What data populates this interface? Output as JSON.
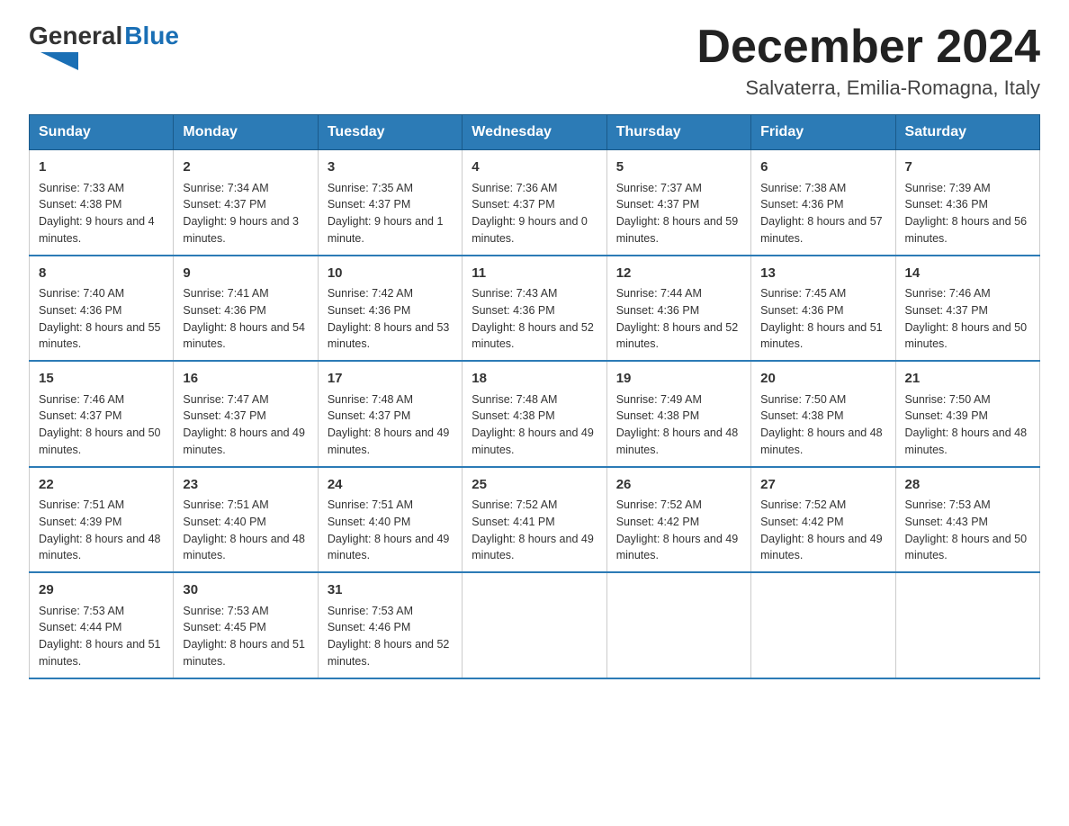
{
  "logo": {
    "text_general": "General",
    "text_blue": "Blue",
    "triangle": "▶"
  },
  "title": "December 2024",
  "subtitle": "Salvaterra, Emilia-Romagna, Italy",
  "days_of_week": [
    "Sunday",
    "Monday",
    "Tuesday",
    "Wednesday",
    "Thursday",
    "Friday",
    "Saturday"
  ],
  "weeks": [
    [
      {
        "num": "1",
        "sunrise": "7:33 AM",
        "sunset": "4:38 PM",
        "daylight": "9 hours and 4 minutes."
      },
      {
        "num": "2",
        "sunrise": "7:34 AM",
        "sunset": "4:37 PM",
        "daylight": "9 hours and 3 minutes."
      },
      {
        "num": "3",
        "sunrise": "7:35 AM",
        "sunset": "4:37 PM",
        "daylight": "9 hours and 1 minute."
      },
      {
        "num": "4",
        "sunrise": "7:36 AM",
        "sunset": "4:37 PM",
        "daylight": "9 hours and 0 minutes."
      },
      {
        "num": "5",
        "sunrise": "7:37 AM",
        "sunset": "4:37 PM",
        "daylight": "8 hours and 59 minutes."
      },
      {
        "num": "6",
        "sunrise": "7:38 AM",
        "sunset": "4:36 PM",
        "daylight": "8 hours and 57 minutes."
      },
      {
        "num": "7",
        "sunrise": "7:39 AM",
        "sunset": "4:36 PM",
        "daylight": "8 hours and 56 minutes."
      }
    ],
    [
      {
        "num": "8",
        "sunrise": "7:40 AM",
        "sunset": "4:36 PM",
        "daylight": "8 hours and 55 minutes."
      },
      {
        "num": "9",
        "sunrise": "7:41 AM",
        "sunset": "4:36 PM",
        "daylight": "8 hours and 54 minutes."
      },
      {
        "num": "10",
        "sunrise": "7:42 AM",
        "sunset": "4:36 PM",
        "daylight": "8 hours and 53 minutes."
      },
      {
        "num": "11",
        "sunrise": "7:43 AM",
        "sunset": "4:36 PM",
        "daylight": "8 hours and 52 minutes."
      },
      {
        "num": "12",
        "sunrise": "7:44 AM",
        "sunset": "4:36 PM",
        "daylight": "8 hours and 52 minutes."
      },
      {
        "num": "13",
        "sunrise": "7:45 AM",
        "sunset": "4:36 PM",
        "daylight": "8 hours and 51 minutes."
      },
      {
        "num": "14",
        "sunrise": "7:46 AM",
        "sunset": "4:37 PM",
        "daylight": "8 hours and 50 minutes."
      }
    ],
    [
      {
        "num": "15",
        "sunrise": "7:46 AM",
        "sunset": "4:37 PM",
        "daylight": "8 hours and 50 minutes."
      },
      {
        "num": "16",
        "sunrise": "7:47 AM",
        "sunset": "4:37 PM",
        "daylight": "8 hours and 49 minutes."
      },
      {
        "num": "17",
        "sunrise": "7:48 AM",
        "sunset": "4:37 PM",
        "daylight": "8 hours and 49 minutes."
      },
      {
        "num": "18",
        "sunrise": "7:48 AM",
        "sunset": "4:38 PM",
        "daylight": "8 hours and 49 minutes."
      },
      {
        "num": "19",
        "sunrise": "7:49 AM",
        "sunset": "4:38 PM",
        "daylight": "8 hours and 48 minutes."
      },
      {
        "num": "20",
        "sunrise": "7:50 AM",
        "sunset": "4:38 PM",
        "daylight": "8 hours and 48 minutes."
      },
      {
        "num": "21",
        "sunrise": "7:50 AM",
        "sunset": "4:39 PM",
        "daylight": "8 hours and 48 minutes."
      }
    ],
    [
      {
        "num": "22",
        "sunrise": "7:51 AM",
        "sunset": "4:39 PM",
        "daylight": "8 hours and 48 minutes."
      },
      {
        "num": "23",
        "sunrise": "7:51 AM",
        "sunset": "4:40 PM",
        "daylight": "8 hours and 48 minutes."
      },
      {
        "num": "24",
        "sunrise": "7:51 AM",
        "sunset": "4:40 PM",
        "daylight": "8 hours and 49 minutes."
      },
      {
        "num": "25",
        "sunrise": "7:52 AM",
        "sunset": "4:41 PM",
        "daylight": "8 hours and 49 minutes."
      },
      {
        "num": "26",
        "sunrise": "7:52 AM",
        "sunset": "4:42 PM",
        "daylight": "8 hours and 49 minutes."
      },
      {
        "num": "27",
        "sunrise": "7:52 AM",
        "sunset": "4:42 PM",
        "daylight": "8 hours and 49 minutes."
      },
      {
        "num": "28",
        "sunrise": "7:53 AM",
        "sunset": "4:43 PM",
        "daylight": "8 hours and 50 minutes."
      }
    ],
    [
      {
        "num": "29",
        "sunrise": "7:53 AM",
        "sunset": "4:44 PM",
        "daylight": "8 hours and 51 minutes."
      },
      {
        "num": "30",
        "sunrise": "7:53 AM",
        "sunset": "4:45 PM",
        "daylight": "8 hours and 51 minutes."
      },
      {
        "num": "31",
        "sunrise": "7:53 AM",
        "sunset": "4:46 PM",
        "daylight": "8 hours and 52 minutes."
      },
      null,
      null,
      null,
      null
    ]
  ],
  "labels": {
    "sunrise": "Sunrise:",
    "sunset": "Sunset:",
    "daylight": "Daylight:"
  }
}
